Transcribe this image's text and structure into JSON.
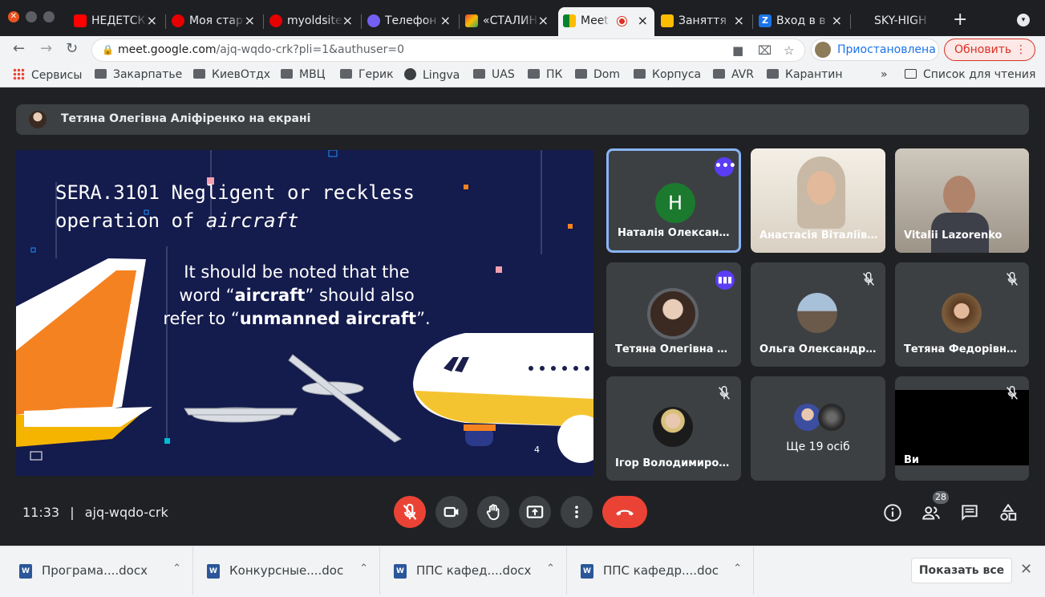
{
  "tabs": [
    {
      "title": "НЕДЕТСКИЕ",
      "icon": "youtube-icon",
      "color": "#ff0000"
    },
    {
      "title": "Моя стартовая",
      "icon": "vodafone-icon",
      "color": "#e60000"
    },
    {
      "title": "myoldsite",
      "icon": "vodafone-icon",
      "color": "#e60000"
    },
    {
      "title": "Телефон",
      "icon": "viber-icon",
      "color": "#7360f2"
    },
    {
      "title": "«СТАЛИН",
      "icon": "gmail-icon",
      "color": "#ea4335"
    },
    {
      "title": "Meet",
      "icon": "meet-icon",
      "color": "#00832d"
    },
    {
      "title": "Заняття",
      "icon": "classroom-icon",
      "color": "#fbbc04"
    },
    {
      "title": "Вход в в",
      "icon": "zoom-icon",
      "color": "#1a73e8"
    },
    {
      "title": "SKY-HIGH",
      "icon": "",
      "color": ""
    }
  ],
  "address": {
    "host": "meet.google.com",
    "path": "/ajq-wqdo-crk?pli=1&authuser=0"
  },
  "profile": {
    "label": "Приостановлена"
  },
  "update": {
    "label": "Обновить"
  },
  "bookmarks": {
    "items": [
      "Сервисы",
      "Закарпатье",
      "КиевОтдх",
      "МВЦ",
      "Герик",
      "Lingva",
      "UAS",
      "ПК",
      "Dom",
      "Корпуса",
      "AVR",
      "Карантин"
    ],
    "more": "»",
    "reading_list": "Список для чтения"
  },
  "presenter": {
    "text": "Тетяна Олегівна Аліфіренко на екрані"
  },
  "slide": {
    "title_line1": "SERA.3101 Negligent or reckless",
    "title_line2": "operation of ",
    "title_italic": "aircraft",
    "body_1": "It should be noted that the",
    "body_2a": "word “",
    "body_2b": "aircraft",
    "body_2c": "” should also",
    "body_3a": "refer to “",
    "body_3b": "unmanned aircraft",
    "body_3c": "”.",
    "page": "4"
  },
  "participants": [
    {
      "name": "Наталія Олександрівна",
      "initial": "Н"
    },
    {
      "name": "Анастасія Віталіївна"
    },
    {
      "name": "Vitalii Lazorenko"
    },
    {
      "name": "Тетяна Олегівна Аліфіренко"
    },
    {
      "name": "Ольга Олександрівна"
    },
    {
      "name": "Тетяна Федорівна Ш"
    },
    {
      "name": "Ігор Володимирович"
    },
    {
      "name": "Ще 19 осіб"
    },
    {
      "name": "Ви"
    }
  ],
  "meeting": {
    "time": "11:33",
    "sep": "|",
    "code": "ajq-wqdo-crk",
    "people_count": "28"
  },
  "downloads": [
    {
      "name": "Програма....docx"
    },
    {
      "name": "Конкурсные....doc"
    },
    {
      "name": "ППС кафед....docx"
    },
    {
      "name": "ППС кафедр....doc"
    }
  ],
  "shelf": {
    "show_all": "Показать все"
  }
}
